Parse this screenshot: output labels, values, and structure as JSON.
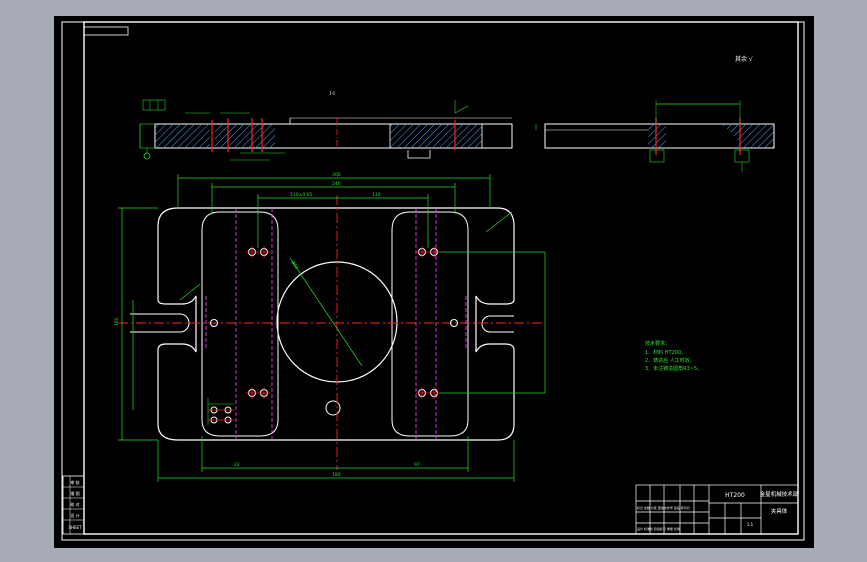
{
  "drawing": {
    "section_mark": "I-I",
    "roughness_note": "其余 √",
    "material_code": "HT200",
    "company": "金星机械技术部",
    "part_name": "夹具体",
    "tech_req": {
      "title": "技术要求：",
      "items": [
        "1、材料 HT200。",
        "2、铸造后 人工时效。",
        "3、未注铸造圆角R3~5。"
      ]
    },
    "left_strip": [
      "审 核",
      "描 图",
      "校 对",
      "设 计",
      "SHEET"
    ],
    "title_block": {
      "rows": [
        "标记 处数 分区 更改文件号 签名 年月日",
        "设计 标准化 阶段标记 重量 比例"
      ],
      "scale": "1:1"
    },
    "dims": {
      "overall_width": "300",
      "inner_width": "240",
      "hole_span": "180",
      "slot_span": "110",
      "center_span": "110±0.05",
      "bore_dia": "Ø80",
      "bottom_left": "22",
      "bottom_right": "97",
      "height_total": "180"
    }
  },
  "colors": {
    "bg": "#000000",
    "frame": "#ffffff",
    "dim": "#22dd22",
    "center": "#ff2020",
    "hidden": "#ff40ff",
    "tech": "#2fe02f",
    "hatch": "#4aa3ff"
  }
}
